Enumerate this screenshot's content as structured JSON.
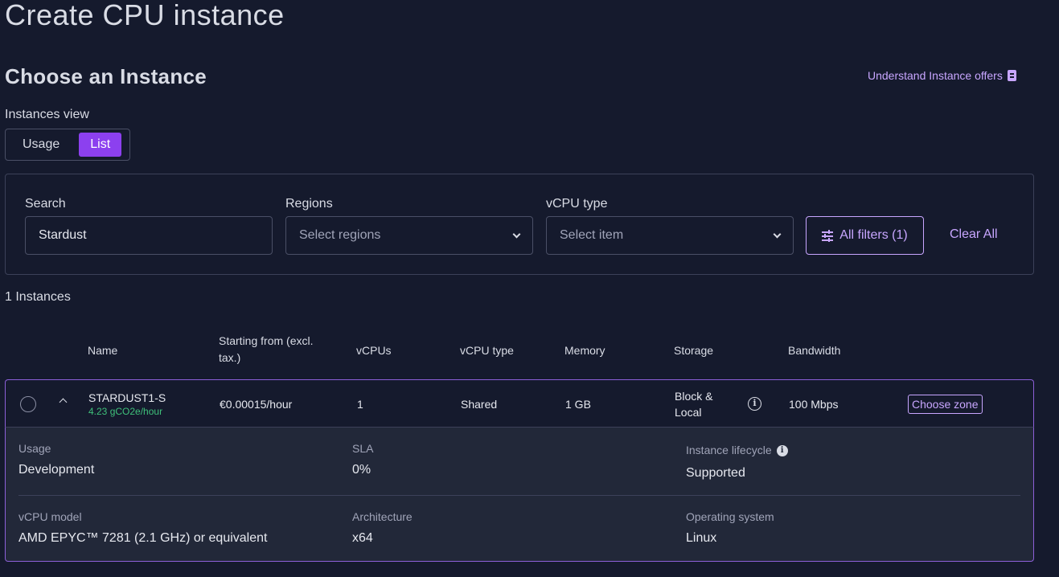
{
  "header": {
    "title": "Create CPU instance",
    "section_title": "Choose an Instance",
    "understand_link": "Understand Instance offers"
  },
  "view": {
    "label": "Instances view",
    "options": [
      "Usage",
      "List"
    ],
    "selected": "List"
  },
  "filters": {
    "search_label": "Search",
    "search_value": "Stardust",
    "regions_label": "Regions",
    "regions_placeholder": "Select regions",
    "vcpu_label": "vCPU type",
    "vcpu_placeholder": "Select item",
    "all_filters": "All filters (1)",
    "clear_all": "Clear All"
  },
  "results": {
    "count": "1 Instances"
  },
  "table": {
    "headers": {
      "name": "Name",
      "price": "Starting from (excl. tax.)",
      "vcpus": "vCPUs",
      "vcpu_type": "vCPU type",
      "memory": "Memory",
      "storage": "Storage",
      "bandwidth": "Bandwidth"
    },
    "rows": [
      {
        "name": "STARDUST1-S",
        "eco": "4.23 gCO2e/hour",
        "price": "€0.00015/hour",
        "vcpus": "1",
        "vcpu_type": "Shared",
        "memory": "1 GB",
        "storage": "Block & Local",
        "bandwidth": "100 Mbps",
        "action": "Choose zone",
        "details": {
          "usage_label": "Usage",
          "usage": "Development",
          "sla_label": "SLA",
          "sla": "0%",
          "lifecycle_label": "Instance lifecycle",
          "lifecycle": "Supported",
          "vcpu_model_label": "vCPU model",
          "vcpu_model": "AMD EPYC™ 7281 (2.1 GHz) or equivalent",
          "arch_label": "Architecture",
          "arch": "x64",
          "os_label": "Operating system",
          "os": "Linux"
        }
      }
    ]
  },
  "colors": {
    "background": "#151a2d",
    "accent": "#8c40ef",
    "link": "#c8a6ff",
    "eco": "#3fc07a"
  }
}
